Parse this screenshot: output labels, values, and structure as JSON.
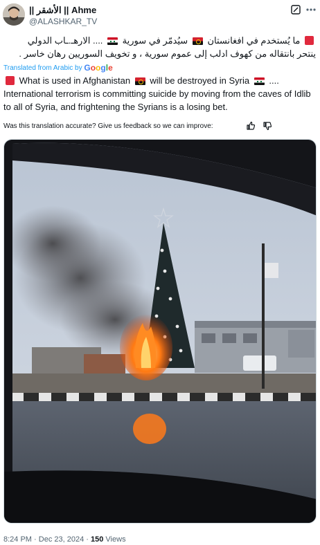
{
  "author": {
    "display_name": "|| الأشقر || Ahme",
    "handle": "@ALASHKAR_TV"
  },
  "icons": {
    "grok": "grok-icon",
    "more": "more-icon",
    "thumbs_up": "thumbs-up-icon",
    "thumbs_down": "thumbs-down-icon"
  },
  "tweet": {
    "arabic_part1": "ما يُستخدم في افغانستان",
    "arabic_part2": "سيُدمّر في سورية",
    "arabic_part3": ".... الارهـ.ـاب الدولي ينتحر بانتقاله من كهوف ادلب إلى عموم سورية ، و تخويف السوريين رهان خاسر .",
    "translated_label": "Translated from Arabic by",
    "google_brand": "Google",
    "english_part1": "What is used in Afghanistan",
    "english_part2": "will be destroyed in Syria",
    "english_part3": "....",
    "english_part4": "International terrorism is committing suicide by moving from the caves of Idlib to all of Syria, and frightening the Syrians is a losing bet.",
    "feedback_prompt": "Was this translation accurate? Give us feedback so we can improve:"
  },
  "colors": {
    "link_blue": "#1d9bf0",
    "text_primary": "#0f1419",
    "text_secondary": "#536471",
    "border": "#cfd9de",
    "fire_orange": "#ff6a00"
  },
  "footer": {
    "time": "8:24 PM",
    "separator": "·",
    "date": "Dec 23, 2024",
    "views_count": "150",
    "views_label": "Views"
  }
}
